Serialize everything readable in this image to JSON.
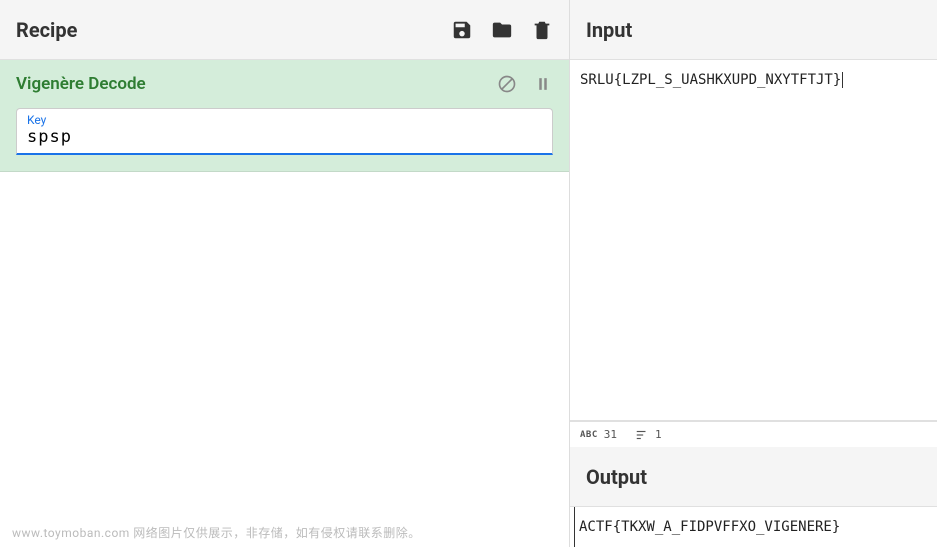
{
  "recipe": {
    "title": "Recipe",
    "operation": {
      "name": "Vigenère Decode",
      "keyLabel": "Key",
      "keyValue": "spsp"
    }
  },
  "input": {
    "title": "Input",
    "value": "SRLU{LZPL_S_UASHKXUPD_NXYTFTJT}",
    "charCount": "31",
    "lineCount": "1"
  },
  "output": {
    "title": "Output",
    "value": "ACTF{TKXW_A_FIDPVFFXO_VIGENERE}"
  },
  "watermark": "www.toymoban.com 网络图片仅供展示，非存储，如有侵权请联系删除。"
}
